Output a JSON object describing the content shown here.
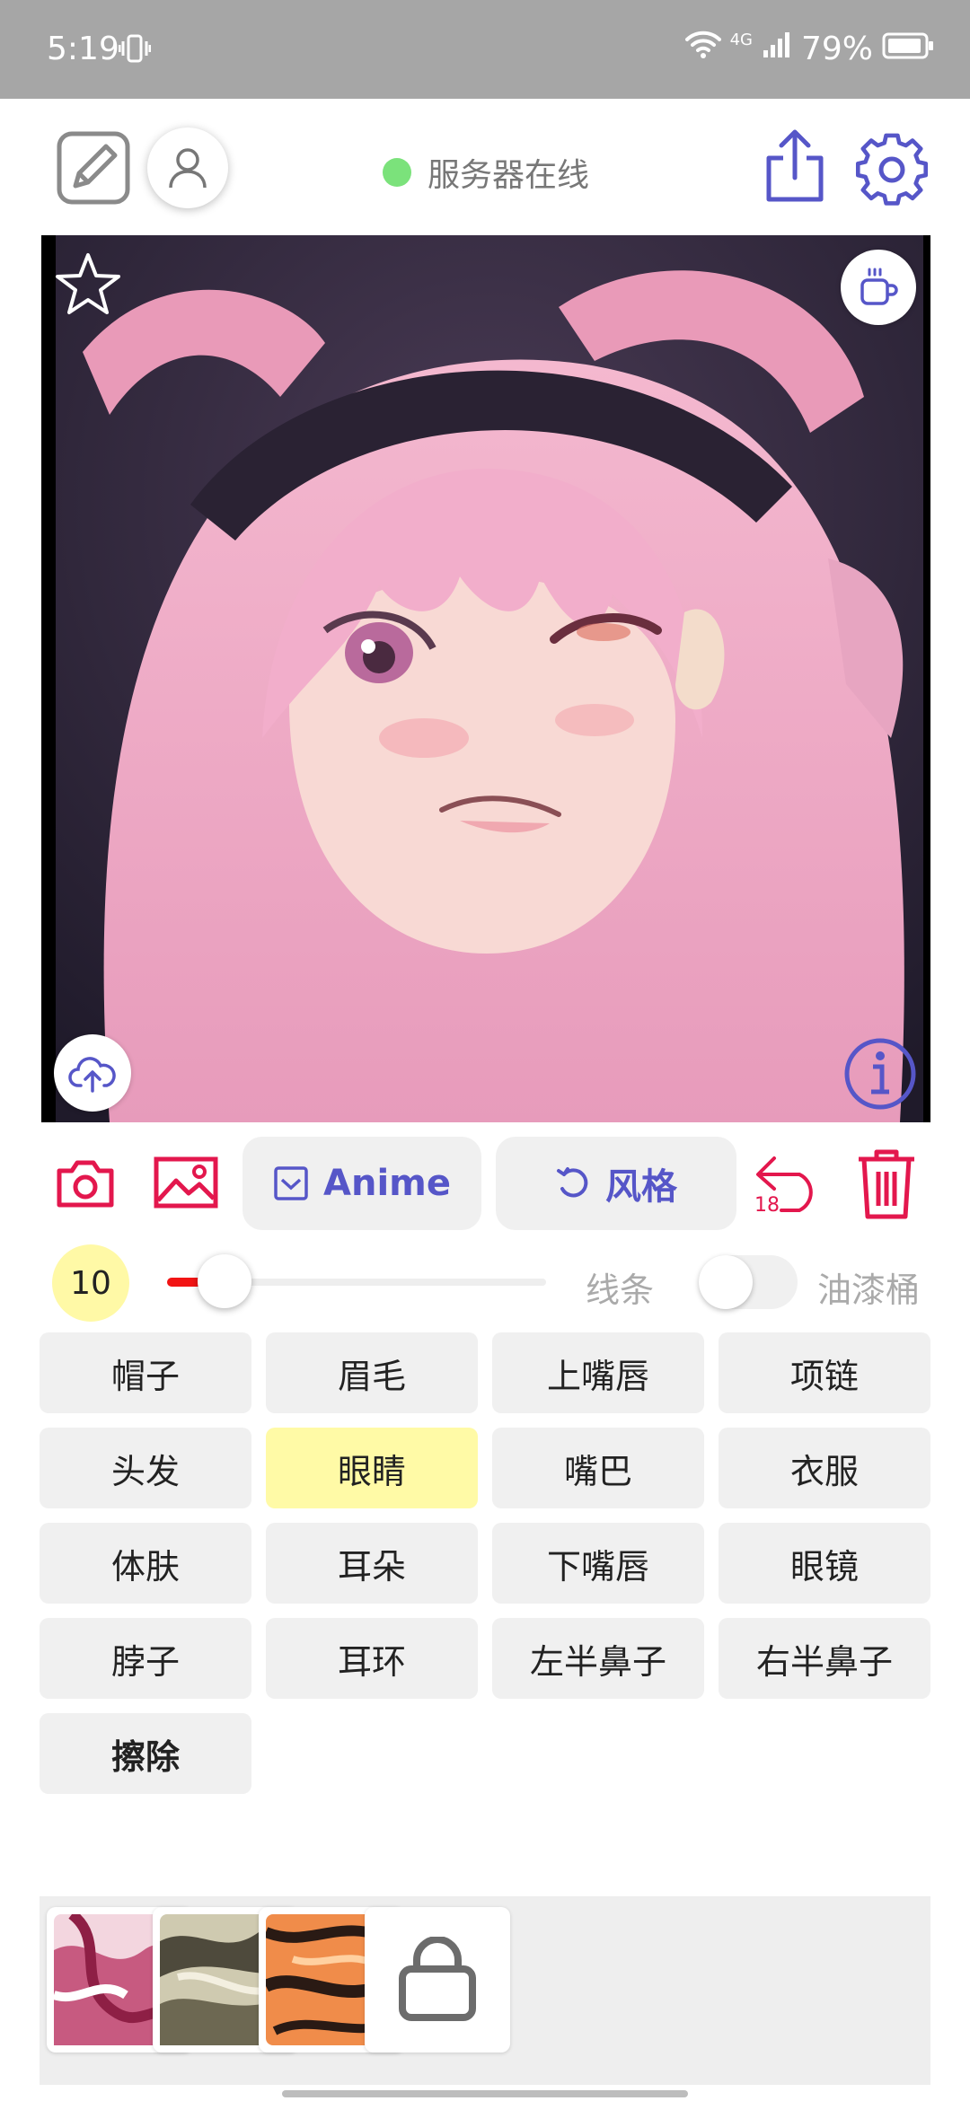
{
  "status_bar": {
    "time": "5:19",
    "network": "4G",
    "battery": "79%"
  },
  "header": {
    "server_status": "服务器在线",
    "server_status_color": "#7be27b"
  },
  "toolbar": {
    "model_label": "Anime",
    "style_label": "风格",
    "undo_count": "18",
    "accent_color": "#e3174d",
    "pill_text_color": "#5656c8"
  },
  "brush": {
    "size": "10",
    "slider_fraction": 0.1,
    "lines_label": "线条",
    "bucket_label": "油漆桶",
    "bucket_enabled": false
  },
  "parts": [
    {
      "label": "帽子"
    },
    {
      "label": "眉毛"
    },
    {
      "label": "上嘴唇"
    },
    {
      "label": "项链"
    },
    {
      "label": "头发"
    },
    {
      "label": "眼睛",
      "active": true
    },
    {
      "label": "嘴巴"
    },
    {
      "label": "衣服"
    },
    {
      "label": "体肤"
    },
    {
      "label": "耳朵"
    },
    {
      "label": "下嘴唇"
    },
    {
      "label": "眼镜"
    },
    {
      "label": "脖子"
    },
    {
      "label": "耳环"
    },
    {
      "label": "左半鼻子"
    },
    {
      "label": "右半鼻子"
    },
    {
      "label": "擦除",
      "bold": true
    }
  ],
  "icons": {
    "sketch": "sketch-icon",
    "avatar": "user-icon",
    "share": "share-icon",
    "settings": "gear-icon",
    "favorite": "star-icon",
    "coffee": "coffee-icon",
    "upload": "cloud-upload-icon",
    "info": "info-icon",
    "camera": "camera-icon",
    "gallery": "image-icon",
    "undo": "undo-icon",
    "delete": "trash-icon",
    "store": "shopping-bag-icon"
  }
}
